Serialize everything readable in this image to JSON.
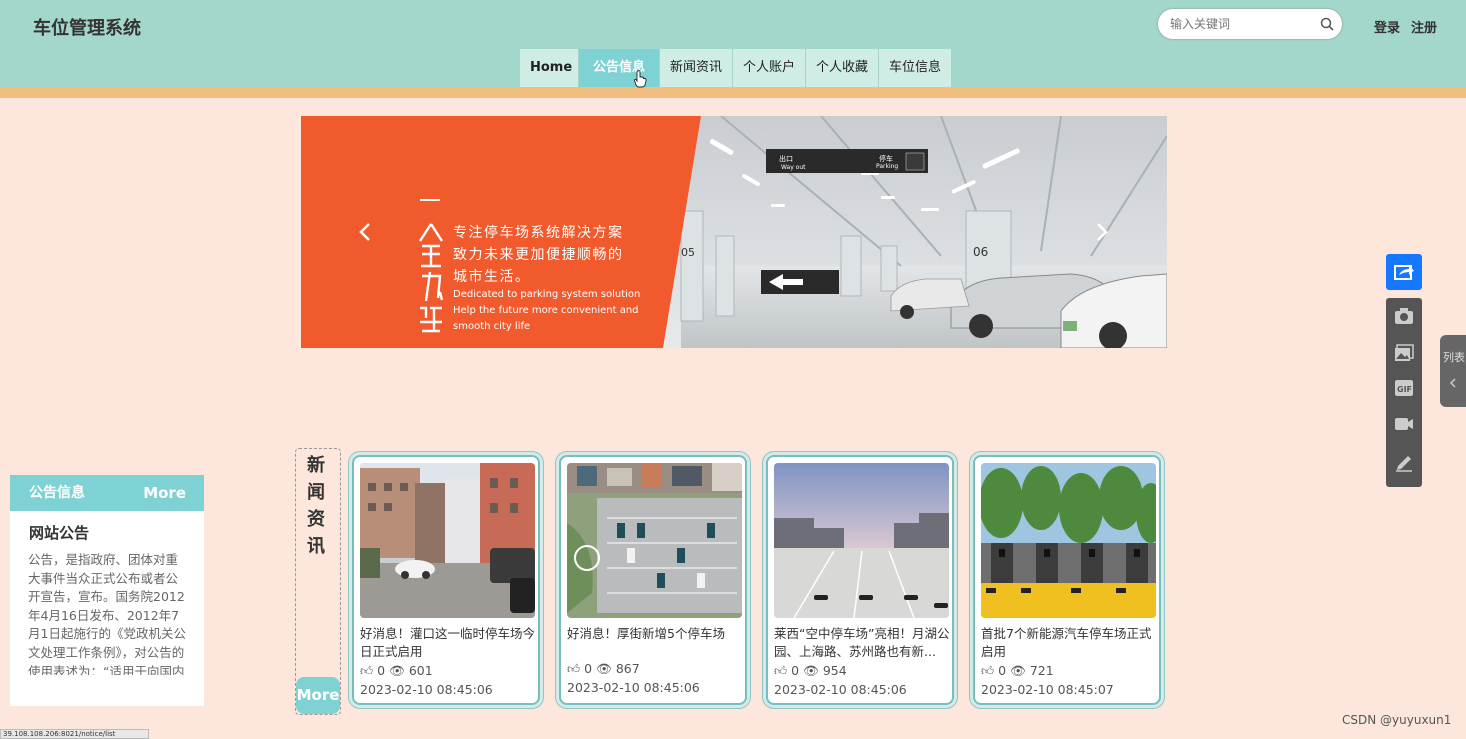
{
  "header": {
    "brand": "车位管理系统",
    "search_placeholder": "输入关键词",
    "login": "登录",
    "register": "注册"
  },
  "nav": {
    "tabs": [
      {
        "label": "Home"
      },
      {
        "label": "公告信息"
      },
      {
        "label": "新闻资讯"
      },
      {
        "label": "个人账户"
      },
      {
        "label": "个人收藏"
      },
      {
        "label": "车位信息"
      }
    ],
    "active_index": 1
  },
  "banner": {
    "line1": "专注停车场系统解决方案",
    "line2": "致力未来更加便捷顺畅的",
    "line3": "城市生活。",
    "en1": "Dedicated to parking system solution",
    "en2": "Help the future more convenient and",
    "en3": "smooth city life",
    "sign_exit": "出口",
    "sign_way_out": "Way out",
    "sign_parking_cn": "停车",
    "sign_parking": "Parking",
    "sign_05": "05",
    "sign_06": "06"
  },
  "notice": {
    "header": "公告信息",
    "more": "More",
    "subtitle": "网站公告",
    "body": "公告，是指政府、团体对重大事件当众正式公布或者公开宣告，宣布。国务院2012年4月16日发布、2012年7月1日起施行的《党政机关公文处理工作条例》，对公告的使用表述为：“适用于向国内外宣布重要事项或者法定"
  },
  "news": {
    "label": "新闻资讯",
    "more": "More",
    "cards": [
      {
        "title": "好消息！灌口这一临时停车场今日正式启用",
        "likes": "0",
        "views": "601",
        "date": "2023-02-10 08:45:06"
      },
      {
        "title": "好消息！厚街新增5个停车场",
        "likes": "0",
        "views": "867",
        "date": "2023-02-10 08:45:06"
      },
      {
        "title": "莱西“空中停车场”亮相！月湖公园、上海路、苏州路也有新...",
        "likes": "0",
        "views": "954",
        "date": "2023-02-10 08:45:06"
      },
      {
        "title": "首批7个新能源汽车停车场正式启用",
        "likes": "0",
        "views": "721",
        "date": "2023-02-10 08:45:07"
      }
    ]
  },
  "side_tools": {
    "list_tab": "列表",
    "icons": [
      "share-icon",
      "camera-icon",
      "image-icon",
      "gif-icon",
      "video-icon",
      "pen-icon"
    ]
  },
  "footer": {
    "watermark": "CSDN @yuyuxun1",
    "status_url": "39.108.108.206:8021/notice/list"
  },
  "colors": {
    "topbar": "#a3d7cb",
    "accent": "#7fd2d4",
    "stripe": "#f2be7d",
    "page_bg": "#fde6dc",
    "banner_orange": "#f05a2c"
  }
}
